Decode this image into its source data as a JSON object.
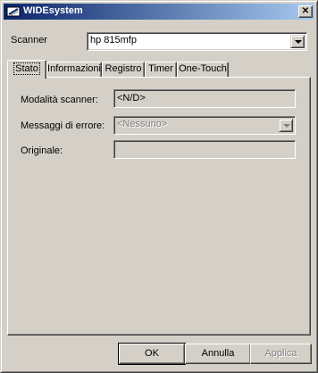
{
  "window": {
    "title": "WIDEsystem"
  },
  "scanner": {
    "label": "Scanner",
    "selected": "hp 815mfp"
  },
  "tabs": [
    {
      "label": "Stato"
    },
    {
      "label": "Informazioni"
    },
    {
      "label": "Registro"
    },
    {
      "label": "Timer"
    },
    {
      "label": "One-Touch"
    }
  ],
  "status": {
    "mode_label": "Modalità scanner:",
    "mode_value": "<N/D>",
    "errors_label": "Messaggi di errore:",
    "errors_value": "<Nessuno>",
    "original_label": "Originale:",
    "original_value": ""
  },
  "buttons": {
    "ok": "OK",
    "cancel": "Annulla",
    "apply": "Applica"
  },
  "colors": {
    "face": "#d4d0c8",
    "title_start": "#0a246a",
    "title_end": "#a6caf0"
  }
}
